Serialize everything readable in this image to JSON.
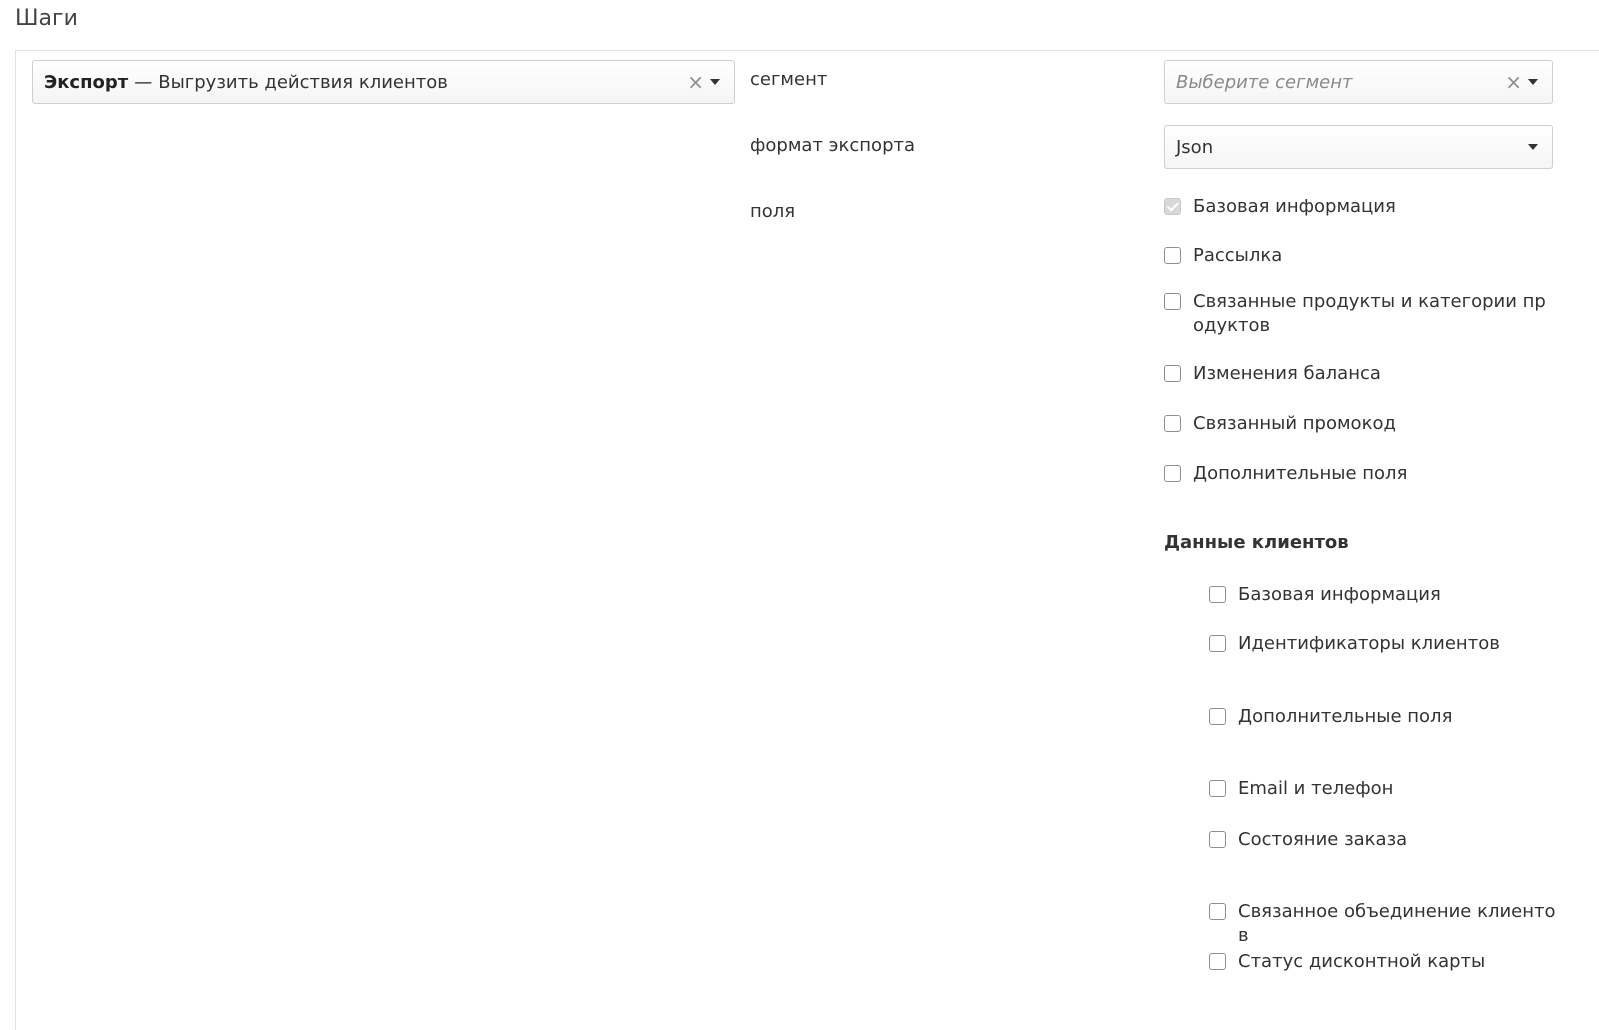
{
  "page_title": "Шаги",
  "step": {
    "kind": "Экспорт",
    "separator": "—",
    "text": "Выгрузить действия клиентов",
    "clear_icon": "×"
  },
  "labels": {
    "segment": "сегмент",
    "export_format": "формат экспорта",
    "fields": "поля"
  },
  "segment_select": {
    "placeholder": "Выберите сегмент",
    "clear_icon": "×"
  },
  "format_select": {
    "value": "Json"
  },
  "fields": [
    {
      "label": "Базовая информация",
      "checked": true,
      "disabled": true
    },
    {
      "label": "Рассылка",
      "checked": false
    },
    {
      "label": "Связанные продукты и категории продуктов",
      "checked": false
    },
    {
      "label": "Изменения баланса",
      "checked": false
    },
    {
      "label": "Связанный промокод",
      "checked": false
    },
    {
      "label": "Дополнительные поля",
      "checked": false
    }
  ],
  "customer_data": {
    "title": "Данные клиентов",
    "fields": [
      {
        "label": "Базовая информация",
        "checked": false
      },
      {
        "label": "Идентификаторы клиентов",
        "checked": false
      },
      {
        "label": "Дополнительные поля",
        "checked": false
      },
      {
        "label": "Email и телефон",
        "checked": false
      },
      {
        "label": "Состояние заказа",
        "checked": false
      },
      {
        "label": "Связанное объединение клиентов",
        "checked": false
      },
      {
        "label": "Статус дисконтной карты",
        "checked": false
      }
    ]
  }
}
